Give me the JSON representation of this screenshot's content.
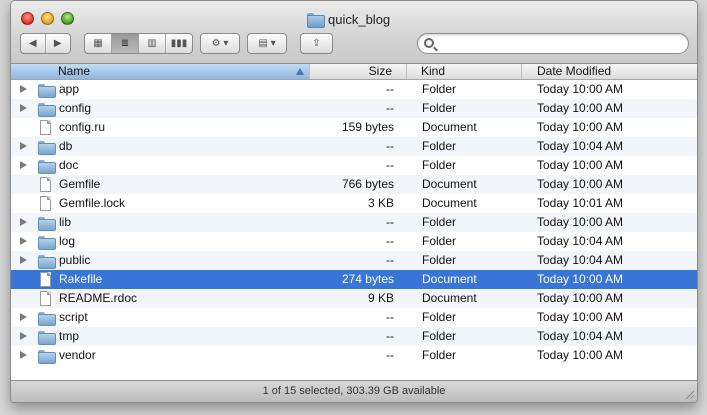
{
  "window": {
    "title": "quick_blog"
  },
  "toolbar": {
    "back_label": "◀",
    "forward_label": "▶",
    "view_icons_label": "▦",
    "view_list_label": "≣",
    "view_columns_label": "▥",
    "view_coverflow_label": "▮▮▮",
    "action_label": "⚙ ▾",
    "arrange_label": "▤ ▾",
    "share_label": "⇪"
  },
  "search": {
    "value": "",
    "placeholder": ""
  },
  "columns": {
    "name": "Name",
    "size": "Size",
    "kind": "Kind",
    "date": "Date Modified"
  },
  "files": [
    {
      "name": "app",
      "size": "--",
      "kind": "Folder",
      "date": "Today 10:00 AM",
      "type": "folder",
      "selected": false
    },
    {
      "name": "config",
      "size": "--",
      "kind": "Folder",
      "date": "Today 10:00 AM",
      "type": "folder",
      "selected": false
    },
    {
      "name": "config.ru",
      "size": "159 bytes",
      "kind": "Document",
      "date": "Today 10:00 AM",
      "type": "document",
      "selected": false
    },
    {
      "name": "db",
      "size": "--",
      "kind": "Folder",
      "date": "Today 10:04 AM",
      "type": "folder",
      "selected": false
    },
    {
      "name": "doc",
      "size": "--",
      "kind": "Folder",
      "date": "Today 10:00 AM",
      "type": "folder",
      "selected": false
    },
    {
      "name": "Gemfile",
      "size": "766 bytes",
      "kind": "Document",
      "date": "Today 10:00 AM",
      "type": "document",
      "selected": false
    },
    {
      "name": "Gemfile.lock",
      "size": "3 KB",
      "kind": "Document",
      "date": "Today 10:01 AM",
      "type": "document",
      "selected": false
    },
    {
      "name": "lib",
      "size": "--",
      "kind": "Folder",
      "date": "Today 10:00 AM",
      "type": "folder",
      "selected": false
    },
    {
      "name": "log",
      "size": "--",
      "kind": "Folder",
      "date": "Today 10:04 AM",
      "type": "folder",
      "selected": false
    },
    {
      "name": "public",
      "size": "--",
      "kind": "Folder",
      "date": "Today 10:04 AM",
      "type": "folder",
      "selected": false
    },
    {
      "name": "Rakefile",
      "size": "274 bytes",
      "kind": "Document",
      "date": "Today 10:00 AM",
      "type": "document",
      "selected": true
    },
    {
      "name": "README.rdoc",
      "size": "9 KB",
      "kind": "Document",
      "date": "Today 10:00 AM",
      "type": "document",
      "selected": false
    },
    {
      "name": "script",
      "size": "--",
      "kind": "Folder",
      "date": "Today 10:00 AM",
      "type": "folder",
      "selected": false
    },
    {
      "name": "tmp",
      "size": "--",
      "kind": "Folder",
      "date": "Today 10:04 AM",
      "type": "folder",
      "selected": false
    },
    {
      "name": "vendor",
      "size": "--",
      "kind": "Folder",
      "date": "Today 10:00 AM",
      "type": "folder",
      "selected": false
    }
  ],
  "status": {
    "text": "1 of 15 selected, 303.39 GB available"
  },
  "colors": {
    "selection": "#3875d7",
    "header_sorted": "#8db7e2"
  }
}
